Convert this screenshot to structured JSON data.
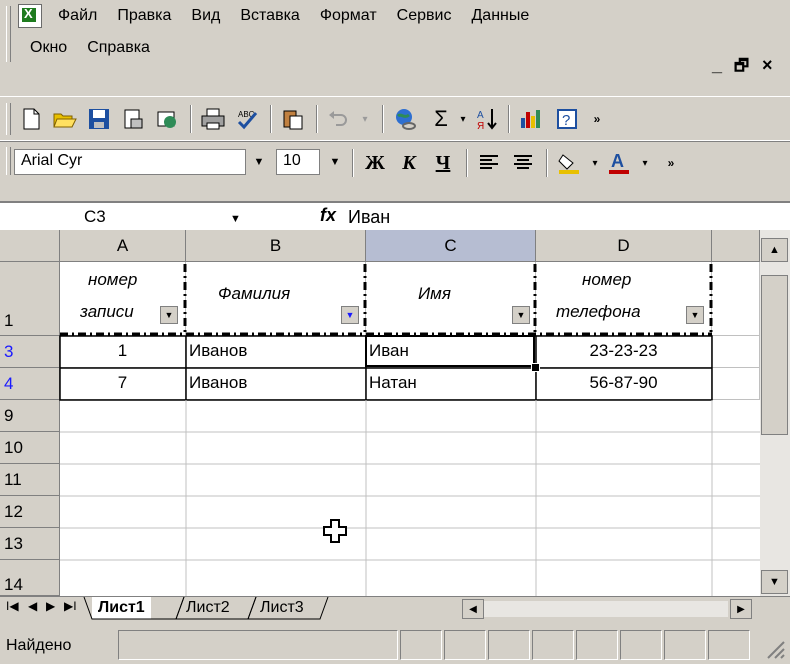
{
  "menu": {
    "items": [
      "Файл",
      "Правка",
      "Вид",
      "Вставка",
      "Формат",
      "Сервис",
      "Данные"
    ],
    "items_row2": [
      "Окно",
      "Справка"
    ],
    "window_controls": [
      "_",
      "🗗",
      "×"
    ]
  },
  "standard_toolbar": {
    "icons": [
      "new-icon",
      "open-icon",
      "save-icon",
      "permission-icon",
      "email-icon",
      "print-icon",
      "spelling-icon",
      "paste-icon",
      "undo-icon",
      "hyperlink-icon",
      "autosum-icon",
      "sort-icon",
      "chart-icon",
      "help-icon"
    ]
  },
  "format_toolbar": {
    "font_name": "Arial Cyr",
    "font_size": "10",
    "bold_label": "Ж",
    "italic_label": "К",
    "underline_label": "Ч"
  },
  "formula_bar": {
    "name_box": "C3",
    "fx_label": "fx",
    "value": "Иван"
  },
  "columns": [
    "A",
    "B",
    "C",
    "D"
  ],
  "header_row": {
    "row_label": "1",
    "a_line1": "номер",
    "a_line2": "записи",
    "b": "Фамилия",
    "c": "Имя",
    "d_line1": "номер",
    "d_line2": "телефона"
  },
  "data_rows": [
    {
      "row": "3",
      "a": "1",
      "b": "Иванов",
      "c": "Иван",
      "d": "23-23-23"
    },
    {
      "row": "4",
      "a": "7",
      "b": "Иванов",
      "c": "Натан",
      "d": "56-87-90"
    }
  ],
  "empty_rows": [
    "9",
    "10",
    "11",
    "12",
    "13",
    "14"
  ],
  "sheet_tabs": [
    "Лист1",
    "Лист2",
    "Лист3"
  ],
  "status": {
    "text": "Найдено"
  },
  "colors": {
    "chrome": "#d4d0c8",
    "selected_column": "#b6bdd2",
    "filtered_row_number": "#1a1aff"
  }
}
